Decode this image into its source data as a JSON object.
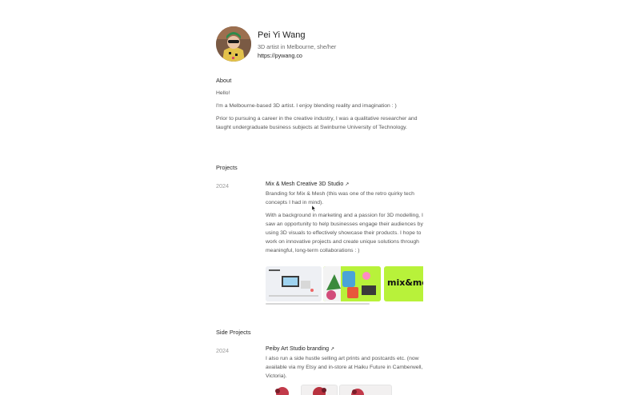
{
  "profile": {
    "name": "Pei Yi Wang",
    "subtitle": "3D artist in Melbourne, she/her",
    "website": "https://pywang.co"
  },
  "about": {
    "heading": "About",
    "paragraphs": [
      "Hello!",
      "I'm a Melbourne-based 3D artist. I enjoy blending reality and imagination : )",
      "Prior to pursuing a career in the creative industry, I was a qualitative researcher and taught undergraduate business subjects at Swinburne University of Technology."
    ]
  },
  "projects": {
    "heading": "Projects",
    "items": [
      {
        "year": "2024",
        "title": "Mix & Mesh Creative 3D Studio",
        "arrow": "↗",
        "description": [
          "Branding for Mix & Mesh (this was one of the retro quirky tech concepts I had in mind).",
          "With a background in marketing and a passion for 3D modelling, I saw an opportunity to help businesses engage their audiences by using 3D visuals to effectively showcase their products. I hope to work on innovative projects and create unique solutions through meaningful, long-term collaborations : )"
        ],
        "thumb_text": "mix&me"
      }
    ]
  },
  "side_projects": {
    "heading": "Side Projects",
    "items": [
      {
        "year": "2024",
        "title": "Peiby Art Studio branding",
        "arrow": "↗",
        "description": "I also run a side hustle selling art prints and postcards etc. (now available via my Etsy and in-store at Haiku Future in Camberwell, Victoria)."
      }
    ]
  },
  "colors": {
    "accent_lime": "#b8f23a",
    "text_dark": "#1f1f1f",
    "text_muted": "#555555",
    "year_gray": "#9a9a9a"
  },
  "icons": [
    "avatar-illustration",
    "external-link-arrow-icon",
    "mouse-cursor-icon"
  ]
}
